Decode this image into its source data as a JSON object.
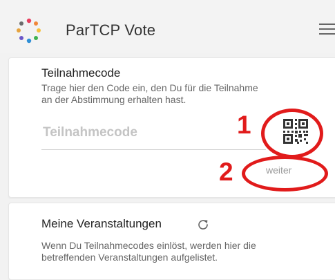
{
  "header": {
    "app_title": "ParTCP Vote",
    "logo_icon": "partcp-logo-icon",
    "menu_icon": "hamburger-menu-icon"
  },
  "code_card": {
    "title": "Teilnahmecode",
    "description_line1": "Trage hier den Code ein, den Du für die Teilnahme",
    "description_line2": "an der Abstimmung erhalten hast.",
    "input_placeholder": "Teilnahmecode",
    "input_value": "",
    "qr_icon": "qr-code-icon",
    "continue_label": "weiter"
  },
  "annotations": {
    "marker_1": "1",
    "marker_2": "2",
    "color": "#e11b1b"
  },
  "events_card": {
    "title": "Meine Veranstaltungen",
    "refresh_icon": "refresh-icon",
    "description_line1": "Wenn Du Teilnahmecodes einlöst, werden hier die",
    "description_line2": "betreffenden Veranstaltungen aufgelistet."
  }
}
